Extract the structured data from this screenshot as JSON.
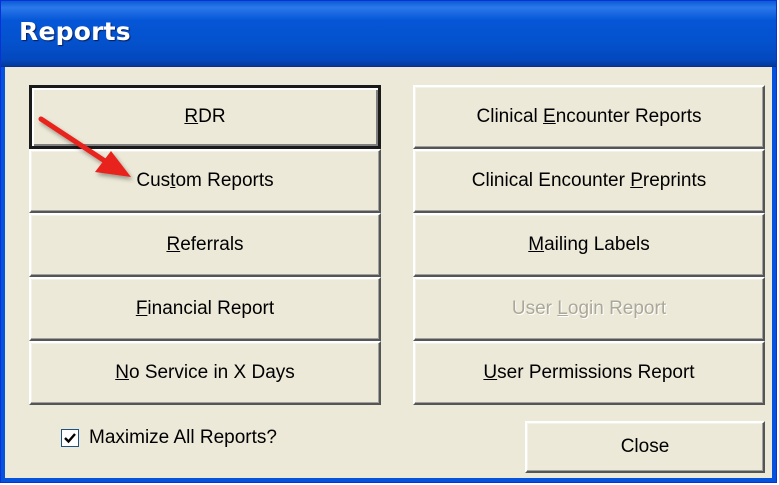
{
  "window": {
    "title": "Reports",
    "accent": "#0556d7"
  },
  "buttons_left": [
    {
      "pre": "",
      "key": "R",
      "post": "DR"
    },
    {
      "pre": "Cus",
      "key": "t",
      "post": "om Reports"
    },
    {
      "pre": "",
      "key": "R",
      "post": "eferrals"
    },
    {
      "pre": "",
      "key": "F",
      "post": "inancial Report"
    },
    {
      "pre": "",
      "key": "N",
      "post": "o Service in X Days"
    }
  ],
  "buttons_right": [
    {
      "pre": "Clinical ",
      "key": "E",
      "post": "ncounter Reports"
    },
    {
      "pre": "Clinical Encounter ",
      "key": "P",
      "post": "reprints"
    },
    {
      "pre": "",
      "key": "M",
      "post": "ailing Labels"
    },
    {
      "pre": "User ",
      "key": "L",
      "post": "ogin Report"
    },
    {
      "pre": "",
      "key": "U",
      "post": "ser Permissions Report"
    }
  ],
  "footer": {
    "checkbox_label": "Maximize All Reports?",
    "checkbox_checked": true,
    "close_label": "Close"
  },
  "annotation": {
    "arrow_color": "#e8211a",
    "icon": "red-arrow-icon"
  }
}
